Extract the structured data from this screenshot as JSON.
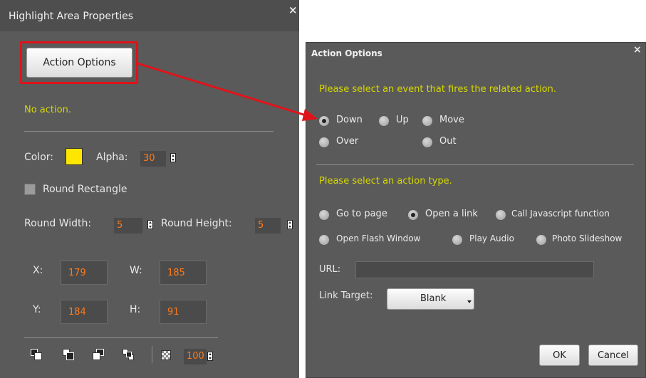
{
  "left_panel": {
    "title": "Highlight Area Properties",
    "close_glyph": "×",
    "action_button": "Action Options",
    "status": "No action.",
    "color_label": "Color:",
    "color_value": "#ffe600",
    "alpha_label": "Alpha:",
    "alpha_value": "30",
    "round_rect_label": "Round Rectangle",
    "round_width_label": "Round Width:",
    "round_width_value": "5",
    "round_height_label": "Round Height:",
    "round_height_value": "5",
    "x_label": "X:",
    "x_value": "179",
    "w_label": "W:",
    "w_value": "185",
    "y_label": "Y:",
    "y_value": "184",
    "h_label": "H:",
    "h_value": "91",
    "opacity_value": "100",
    "arrange_icons": [
      "bring-to-front-icon",
      "send-to-back-icon",
      "bring-forward-icon",
      "send-backward-icon"
    ]
  },
  "dialog": {
    "title": "Action Options",
    "close_glyph": "×",
    "event_prompt": "Please select an event that fires the related action.",
    "events": [
      "Down",
      "Up",
      "Move",
      "Over",
      "Out"
    ],
    "selected_event": "Down",
    "action_prompt": "Please select an action type.",
    "actions": [
      "Go to page",
      "Open a link",
      "Call Javascript function",
      "Open Flash Window",
      "Play Audio",
      "Photo Slideshow"
    ],
    "selected_action": "Open a link",
    "url_label": "URL:",
    "url_value": "",
    "link_target_label": "Link Target:",
    "link_target_value": "Blank",
    "ok_label": "OK",
    "cancel_label": "Cancel"
  },
  "colors": {
    "panel_bg": "#5a5a5a",
    "highlight_red": "#e0131a",
    "prompt_yellow": "#d7d700",
    "value_orange": "#ff7a1a"
  }
}
